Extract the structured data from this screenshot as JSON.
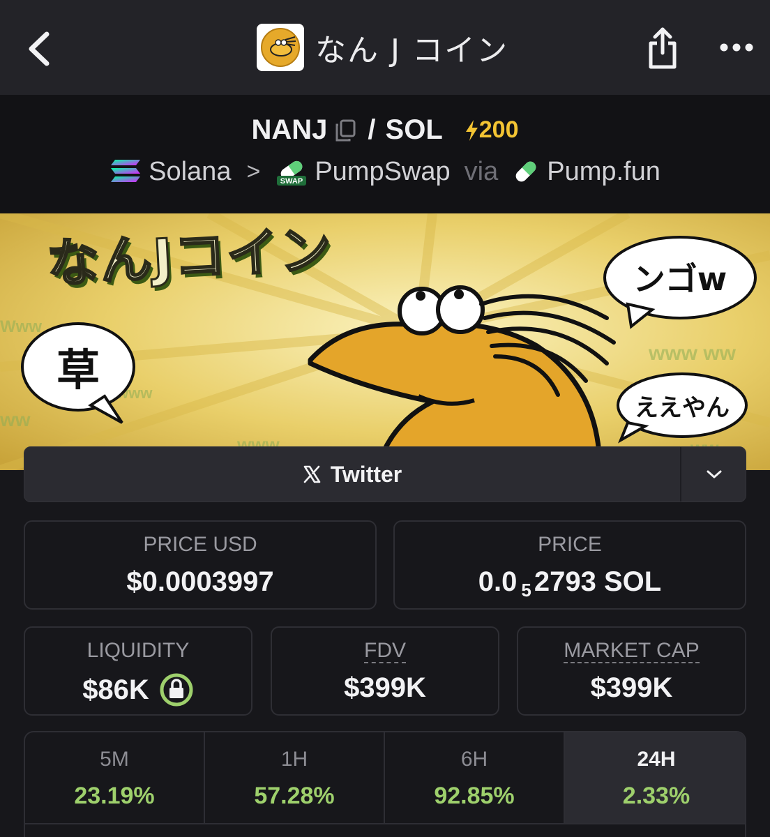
{
  "nav": {
    "title": "なん J コイン",
    "icons": {
      "back": "chevron-left-icon",
      "share": "share-icon",
      "more": "more-dots-icon"
    }
  },
  "pair": {
    "base": "NANJ",
    "quote": "SOL",
    "slash": "/",
    "boost": "200",
    "chain": "Solana",
    "dex": "PumpSwap",
    "via": "via",
    "launchpad": "Pump.fun"
  },
  "banner": {
    "title": "なんJコイン",
    "bubbles": [
      "ンゴw",
      "草",
      "ええやん"
    ]
  },
  "social": {
    "twitter_label": "Twitter"
  },
  "stats": {
    "price_usd_label": "PRICE USD",
    "price_usd": "$0.0003997",
    "price_label": "PRICE",
    "price_prefix": "0.0",
    "price_zeros": "5",
    "price_suffix": "2793 SOL",
    "liquidity_label": "LIQUIDITY",
    "liquidity": "$86K",
    "fdv_label": "FDV",
    "fdv": "$399K",
    "mcap_label": "MARKET CAP",
    "mcap": "$399K"
  },
  "timeframes": [
    {
      "label": "5M",
      "change": "23.19%"
    },
    {
      "label": "1H",
      "change": "57.28%"
    },
    {
      "label": "6H",
      "change": "92.85%"
    },
    {
      "label": "24H",
      "change": "2.33%"
    }
  ],
  "colors": {
    "background": "#17171b",
    "topbar": "#232328",
    "positive": "#9ed06c",
    "boost": "#f3c433",
    "lock": "#9ed06c"
  }
}
